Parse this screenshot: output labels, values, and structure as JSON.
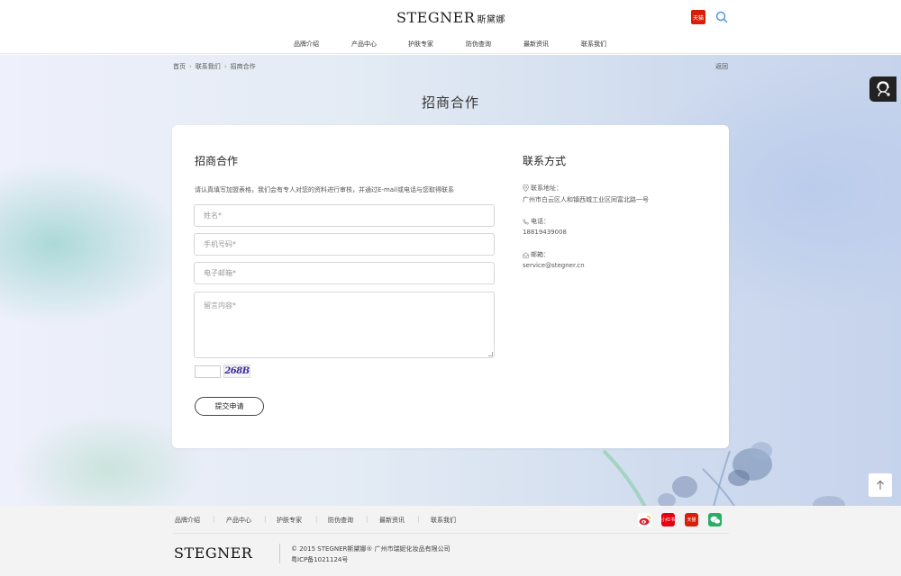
{
  "header": {
    "logo_text": "STEGNER",
    "logo_cn": "斯黛娜",
    "tmall_badge": "天猫",
    "search_icon": "search-icon",
    "nav": [
      "品牌介绍",
      "产品中心",
      "护肤专家",
      "防伪查询",
      "最新资讯",
      "联系我们"
    ]
  },
  "breadcrumb": {
    "items": [
      "首页",
      "联系我们",
      "招商合作"
    ],
    "separator": "›",
    "back": "返回"
  },
  "page_title": "招商合作",
  "form": {
    "title": "招商合作",
    "description": "请认真填写加盟表格，我们会有专人对您的资料进行审核，并通过E-mail或电话与您取得联系",
    "name_placeholder": "姓名*",
    "phone_placeholder": "手机号码*",
    "email_placeholder": "电子邮箱*",
    "message_placeholder": "留言内容*",
    "captcha_text": "268B",
    "submit_label": "提交申请"
  },
  "contact": {
    "title": "联系方式",
    "address_label": "联系地址：",
    "address_value": "广州市白云区人和镇西城工业区同富北路一号",
    "phone_label": "电话：",
    "phone_value": "18819439008",
    "email_label": "邮箱：",
    "email_value": "service@stegner.cn"
  },
  "footer": {
    "nav": [
      "品牌介绍",
      "产品中心",
      "护肤专家",
      "防伪查询",
      "最新资讯",
      "联系我们"
    ],
    "nav_separator": "|",
    "social": [
      {
        "name": "weibo-icon",
        "color": "#f8b517"
      },
      {
        "name": "xiaohongshu-icon",
        "label": "小红书",
        "color": "#e60012"
      },
      {
        "name": "tmall-icon",
        "label": "天猫",
        "color": "#d81e06"
      },
      {
        "name": "wechat-icon",
        "color": "#2aae67"
      }
    ],
    "logo_text": "STEGNER",
    "copyright": "© 2015 STEGNER斯黛娜® 广州市瑞妮化妆品有限公司",
    "icp": "粤ICP备1021124号"
  },
  "colors": {
    "tmall_red": "#d81e06",
    "button_border": "#444444",
    "customer_service_bg": "#222222"
  }
}
